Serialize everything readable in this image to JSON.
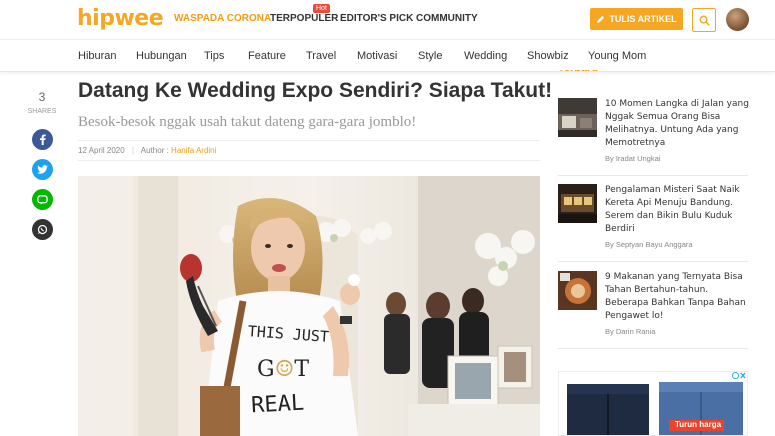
{
  "header": {
    "logo": "hipwee",
    "nav": [
      "WASPADA CORONA",
      "TERPOPULER",
      "EDITOR'S PICK",
      "COMMUNITY"
    ],
    "hot_badge": "Hot",
    "write_button": "TULIS ARTIKEL",
    "accent_color": "#f5a623"
  },
  "categories": [
    "Hiburan",
    "Hubungan",
    "Tips",
    "Feature",
    "Travel",
    "Motivasi",
    "Style",
    "Wedding",
    "Showbiz",
    "Young Mom"
  ],
  "share": {
    "count": "3",
    "label": "SHARES",
    "buttons": [
      {
        "icon": "facebook-icon",
        "glyph": "f",
        "color": "#3b5998"
      },
      {
        "icon": "twitter-icon",
        "glyph": "t",
        "color": "#1da1f2"
      },
      {
        "icon": "line-icon",
        "glyph": "L",
        "color": "#00b900"
      },
      {
        "icon": "whatsapp-icon",
        "glyph": "w",
        "color": "#333333"
      }
    ]
  },
  "article": {
    "title": "Datang Ke Wedding Expo Sendiri? Siapa Takut!",
    "subtitle": "Besok-besok nggak usah takut dateng gara-gara jomblo!",
    "date": "12 April 2020",
    "author_label": "Author :",
    "author": "Hanifa Ardini",
    "shirt_text": "THIS JUST GOT REAL"
  },
  "sidebar": {
    "heading": "Terbaru",
    "items": [
      {
        "title": "10 Momen Langka di Jalan yang Nggak Semua Orang Bisa Melihatnya. Untung Ada yang Memotretnya",
        "byline": "By Iradat Ungkai"
      },
      {
        "title": "Pengalaman Misteri Saat Naik Kereta Api Menuju Bandung. Serem dan Bikin Bulu Kuduk Berdiri",
        "byline": "By Septyan Bayu Anggara"
      },
      {
        "title": "9 Makanan yang Ternyata Bisa Tahan Bertahun-tahun. Beberapa Bahkan Tanpa Bahan Pengawet lo!",
        "byline": "By Darin Rania"
      }
    ],
    "ad_label": "Turun harga"
  }
}
